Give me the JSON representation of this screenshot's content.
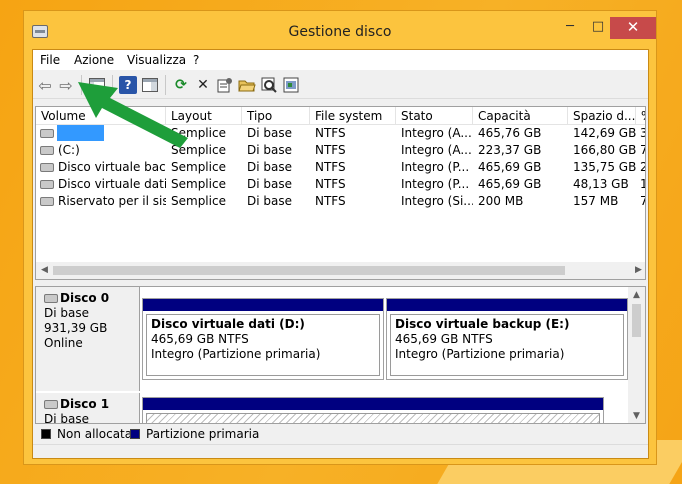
{
  "window": {
    "title": "Gestione disco"
  },
  "controls": {
    "minimize": "─",
    "maximize": "□",
    "close": "✕"
  },
  "menu": {
    "items": [
      "File",
      "Azione",
      "Visualizza",
      "?"
    ]
  },
  "toolbar": {
    "icons": [
      "back-arrow-icon",
      "forward-arrow-icon",
      "show-hide-console-icon",
      "help-icon",
      "console-properties-icon",
      "refresh-icon",
      "delete-icon",
      "properties-icon",
      "open-icon",
      "rescan-disks-icon",
      "help-topics-icon"
    ],
    "glyphs": {
      "back": "⇦",
      "forward": "⇨",
      "help": "?",
      "refresh": "⟳",
      "delete": "✕"
    }
  },
  "volume_table": {
    "columns": [
      "Volume",
      "Layout",
      "Tipo",
      "File system",
      "Stato",
      "Capacità",
      "Spazio d...",
      "%"
    ],
    "rows": [
      [
        "",
        "Semplice",
        "Di base",
        "NTFS",
        "Integro (A...",
        "465,76 GB",
        "142,69 GB",
        "3"
      ],
      [
        "(C:)",
        "Semplice",
        "Di base",
        "NTFS",
        "Integro (A...",
        "223,37 GB",
        "166,80 GB",
        "7"
      ],
      [
        "Disco virtuale backup (E:)",
        "Semplice",
        "Di base",
        "NTFS",
        "Integro (P...",
        "465,69 GB",
        "135,75 GB",
        "2"
      ],
      [
        "Disco virtuale dati (D:)",
        "Semplice",
        "Di base",
        "NTFS",
        "Integro (P...",
        "465,69 GB",
        "48,13 GB",
        "1"
      ],
      [
        "Riservato per il sistema",
        "Semplice",
        "Di base",
        "NTFS",
        "Integro (Si...",
        "200 MB",
        "157 MB",
        "7"
      ]
    ]
  },
  "disks": [
    {
      "name": "Disco 0",
      "type": "Di base",
      "size": "931,39 GB",
      "status": "Online",
      "partitions": [
        {
          "title": "Disco virtuale dati  (D:)",
          "size_fs": "465,69 GB NTFS",
          "state": "Integro (Partizione primaria)"
        },
        {
          "title": "Disco virtuale backup  (E:)",
          "size_fs": "465,69 GB NTFS",
          "state": "Integro (Partizione primaria)"
        }
      ]
    },
    {
      "name": "Disco 1",
      "type": "Di base"
    }
  ],
  "legend": [
    {
      "label": "Non allocata",
      "color": "#000000"
    },
    {
      "label": "Partizione primaria",
      "color": "#000080"
    }
  ],
  "colors": {
    "selection": "#3399ff",
    "primary_partition": "#000080",
    "annotation_arrow": "#1e9e3a",
    "close_button": "#c74a4a"
  }
}
